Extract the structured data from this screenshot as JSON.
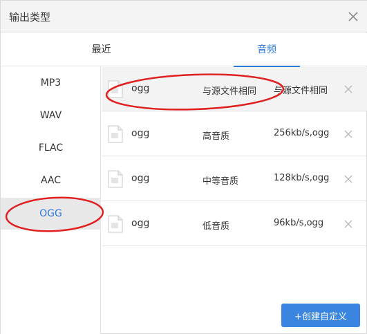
{
  "dialog": {
    "title": "输出类型"
  },
  "tabs": [
    {
      "label": "最近",
      "active": false
    },
    {
      "label": "音频",
      "active": true
    }
  ],
  "formats": [
    {
      "label": "MP3",
      "selected": false
    },
    {
      "label": "WAV",
      "selected": false
    },
    {
      "label": "FLAC",
      "selected": false
    },
    {
      "label": "AAC",
      "selected": false
    },
    {
      "label": "OGG",
      "selected": true
    }
  ],
  "presets": [
    {
      "name": "ogg",
      "quality": "与源文件相同",
      "bitrate": "与源文件相同"
    },
    {
      "name": "ogg",
      "quality": "高音质",
      "bitrate": "256kb/s,ogg"
    },
    {
      "name": "ogg",
      "quality": "中等音质",
      "bitrate": "128kb/s,ogg"
    },
    {
      "name": "ogg",
      "quality": "低音质",
      "bitrate": "96kb/s,ogg"
    }
  ],
  "actions": {
    "create_label": "+创建自定义"
  },
  "colors": {
    "accent": "#2d78d6",
    "button": "#3a85e0",
    "annotation": "#e02020"
  }
}
